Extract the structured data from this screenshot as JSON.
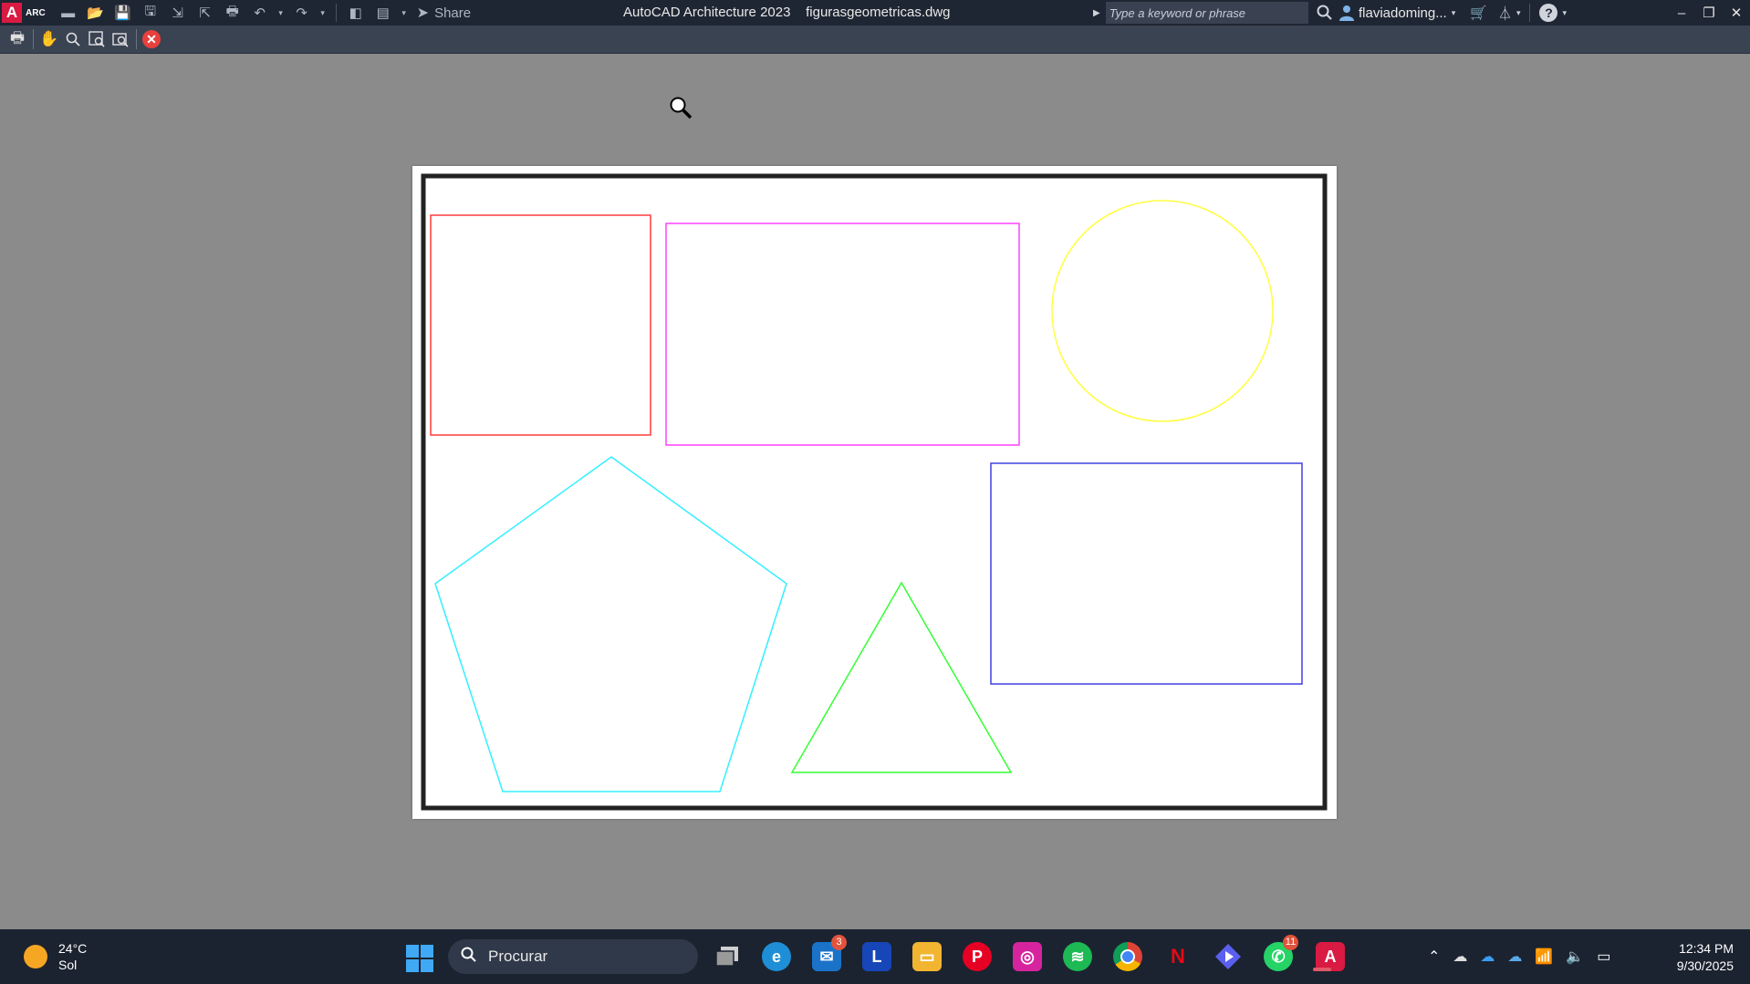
{
  "titlebar": {
    "logo_letter": "A",
    "logo_badge": "ARC",
    "share_label": "Share",
    "app_title": "AutoCAD Architecture 2023    figurasgeometricas.dwg",
    "search_placeholder": "Type a keyword or phrase",
    "username": "flaviadoming...",
    "help_label": "?",
    "quick_access_icons": [
      "new-icon",
      "open-icon",
      "save-icon",
      "save-as-icon",
      "export-icon",
      "import-icon",
      "plot-icon",
      "undo-icon",
      "redo-icon",
      "workspace-icon",
      "publish-icon",
      "customize-icon",
      "share-icon"
    ]
  },
  "toolbar": {
    "icons": [
      "plot-icon",
      "pan-icon",
      "zoom-icon",
      "zoom-window-icon",
      "zoom-original-icon",
      "close-preview-icon"
    ],
    "close_label": "✕"
  },
  "drawing": {
    "colors": {
      "border": "#222222",
      "square": "#ff3b3b",
      "rectangle": "#ff40ff",
      "circle": "#ffff40",
      "pentagon": "#33f0ff",
      "triangle": "#33ff33",
      "blue_rectangle": "#4040e0"
    },
    "shapes": [
      "square",
      "rectangle",
      "circle",
      "pentagon",
      "triangle",
      "blue_rectangle"
    ]
  },
  "taskbar": {
    "weather_temp": "24°C",
    "weather_desc": "Sol",
    "search_label": "Procurar",
    "apps": [
      {
        "name": "task-view-icon",
        "badge": ""
      },
      {
        "name": "edge-icon",
        "badge": ""
      },
      {
        "name": "mail-icon",
        "badge": "3"
      },
      {
        "name": "l-app-icon",
        "badge": ""
      },
      {
        "name": "file-explorer-icon",
        "badge": ""
      },
      {
        "name": "pinterest-icon",
        "badge": ""
      },
      {
        "name": "instagram-icon",
        "badge": ""
      },
      {
        "name": "spotify-icon",
        "badge": ""
      },
      {
        "name": "chrome-icon",
        "badge": ""
      },
      {
        "name": "netflix-icon",
        "badge": ""
      },
      {
        "name": "prime-video-icon",
        "badge": ""
      },
      {
        "name": "whatsapp-icon",
        "badge": "11"
      },
      {
        "name": "autocad-icon",
        "badge": ""
      }
    ],
    "clock_time": "12:34 PM",
    "clock_date": "9/30/2025"
  }
}
